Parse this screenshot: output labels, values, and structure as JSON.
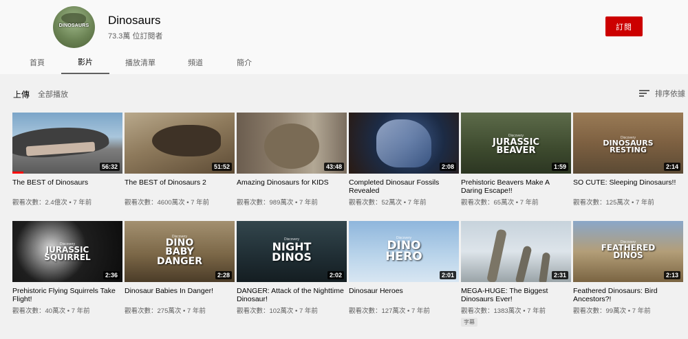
{
  "channel": {
    "name": "Dinosaurs",
    "subscribers": "73.3萬 位訂閱者",
    "avatar_text": "DINOSAURS",
    "subscribe_label": "訂閱"
  },
  "tabs": [
    {
      "label": "首頁",
      "active": false
    },
    {
      "label": "影片",
      "active": true
    },
    {
      "label": "播放清單",
      "active": false
    },
    {
      "label": "頻道",
      "active": false
    },
    {
      "label": "簡介",
      "active": false
    }
  ],
  "section": {
    "title": "上傳",
    "play_all": "全部播放",
    "sort_label": "排序依據"
  },
  "videos": [
    {
      "title": "The BEST of Dinosaurs",
      "views": "觀看次數：2.4億次",
      "age": "7 年前",
      "duration": "56:32",
      "progress": 0.1
    },
    {
      "title": "The BEST of Dinosaurs 2",
      "views": "觀看次數：4600萬次",
      "age": "7 年前",
      "duration": "51:52"
    },
    {
      "title": "Amazing Dinosaurs for KIDS",
      "views": "觀看次數：989萬次",
      "age": "7 年前",
      "duration": "43:48"
    },
    {
      "title": "Completed Dinosaur Fossils Revealed",
      "views": "觀看次數：52萬次",
      "age": "7 年前",
      "duration": "2:08"
    },
    {
      "title": "Prehistoric Beavers Make A Daring Escape!!",
      "views": "觀看次數：65萬次",
      "age": "7 年前",
      "duration": "1:59",
      "thumb_title": "JURASSIC BEAVER",
      "brand": "Discovery"
    },
    {
      "title": "SO CUTE: Sleeping Dinosaurs!!",
      "views": "觀看次數：125萬次",
      "age": "7 年前",
      "duration": "2:14",
      "thumb_title": "DINOSAURS RESTING",
      "brand": "Discovery"
    },
    {
      "title": "Prehistoric Flying Squirrels Take Flight!",
      "views": "觀看次數：40萬次",
      "age": "7 年前",
      "duration": "2:36",
      "thumb_title": "JURASSIC SQUIRREL",
      "brand": "Discovery"
    },
    {
      "title": "Dinosaur Babies In Danger!",
      "views": "觀看次數：275萬次",
      "age": "7 年前",
      "duration": "2:28",
      "thumb_title": "DINO BABY DANGER",
      "brand": "Discovery"
    },
    {
      "title": "DANGER: Attack of the Nighttime Dinosaur!",
      "views": "觀看次數：102萬次",
      "age": "7 年前",
      "duration": "2:02",
      "thumb_title": "NIGHT DINOS",
      "brand": "Discovery"
    },
    {
      "title": "Dinosaur Heroes",
      "views": "觀看次數：127萬次",
      "age": "7 年前",
      "duration": "2:01",
      "thumb_title": "DINO HERO",
      "brand": "Discovery"
    },
    {
      "title": "MEGA-HUGE: The Biggest Dinosaurs Ever!",
      "views": "觀看次數：1383萬次",
      "age": "7 年前",
      "duration": "2:31",
      "badge": "字幕"
    },
    {
      "title": "Feathered Dinosaurs: Bird Ancestors?!",
      "views": "觀看次數：99萬次",
      "age": "7 年前",
      "duration": "2:13",
      "thumb_title": "FEATHERED DINOS",
      "brand": "Discovery"
    }
  ]
}
